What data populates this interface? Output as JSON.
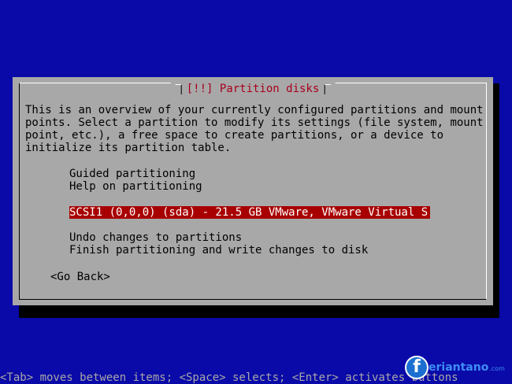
{
  "dialog": {
    "title": "[!!] Partition disks",
    "description": [
      "This is an overview of your currently configured partitions and mount",
      "points. Select a partition to modify its settings (file system, mount",
      "point, etc.), a free space to create partitions, or a device to",
      "initialize its partition table."
    ],
    "items": [
      "Guided partitioning",
      "Help on partitioning",
      "SCSI1 (0,0,0) (sda) - 21.5 GB VMware, VMware Virtual S",
      "Undo changes to partitions",
      "Finish partitioning and write changes to disk"
    ],
    "selected_index": 2,
    "go_back_label": "<Go Back>"
  },
  "footer": {
    "hint": "<Tab> moves between items; <Space> selects; <Enter> activates buttons"
  },
  "watermark": {
    "logo_letter": "f",
    "text": "eriantano",
    "domain": ".com"
  },
  "colors": {
    "background": "#0a0aa8",
    "dialog": "#a8a8a8",
    "title_text": "#a8001c",
    "selection": "#a80000"
  }
}
